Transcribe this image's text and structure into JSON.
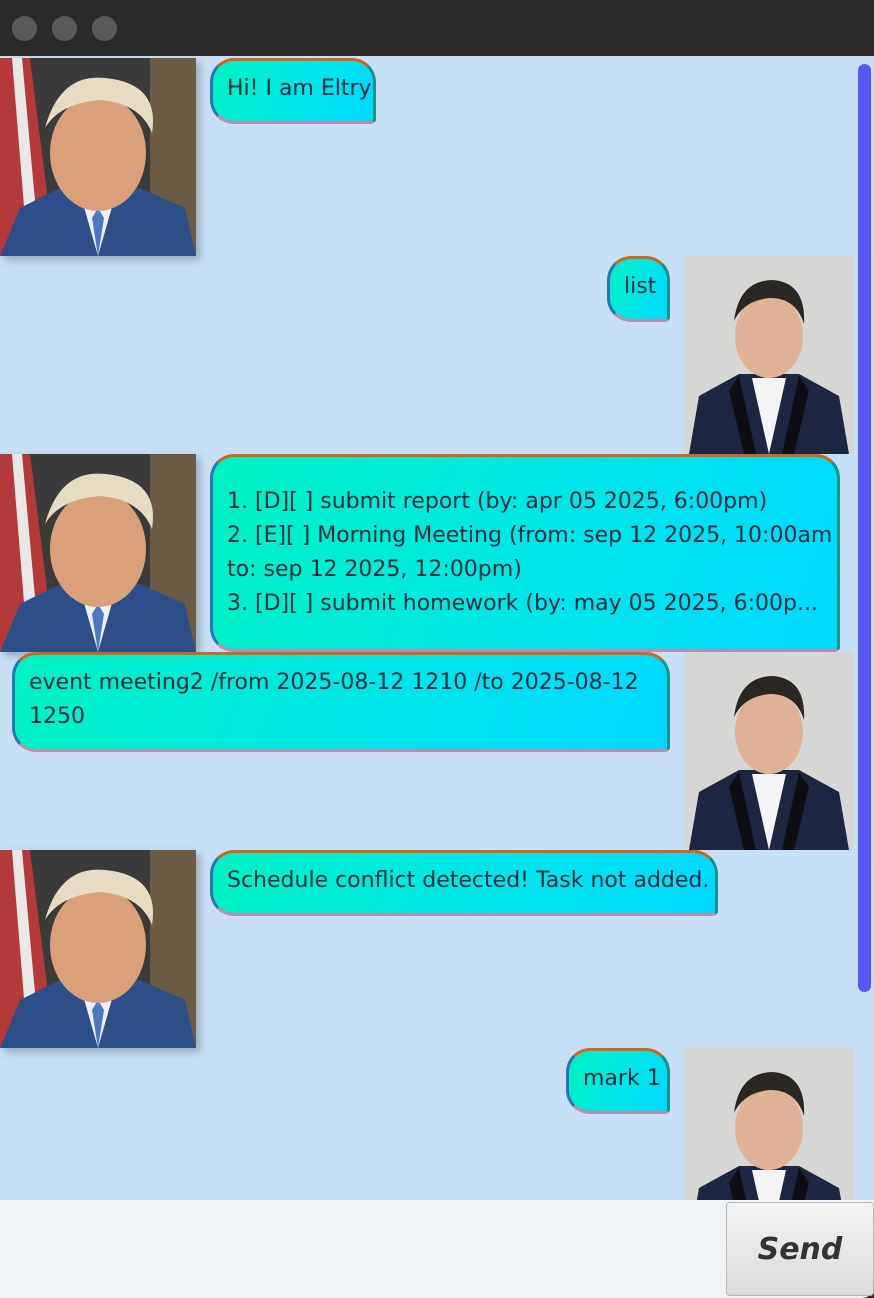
{
  "window": {
    "controls": [
      "close-dot",
      "minimize-dot",
      "zoom-dot"
    ]
  },
  "messages": [
    {
      "sender": "bot",
      "text": "Hi! I am Eltry"
    },
    {
      "sender": "user",
      "text": "list"
    },
    {
      "sender": "bot",
      "text": "1. [D][ ] submit report (by: apr 05 2025, 6:00pm)\n2. [E][ ] Morning Meeting (from: sep 12 2025, 10:00am\nto: sep 12 2025, 12:00pm)\n3. [D][ ] submit homework (by: may 05 2025, 6:00p..."
    },
    {
      "sender": "user",
      "text": "event meeting2 /from 2025-08-12 1210 /to 2025-08-12\n1250"
    },
    {
      "sender": "bot",
      "text": "Schedule conflict detected! Task not added."
    },
    {
      "sender": "user",
      "text": "mark 1"
    }
  ],
  "input": {
    "value": "",
    "placeholder": ""
  },
  "send_label": "Send",
  "colors": {
    "chat_background": "#c8e0f6",
    "bubble_gradient_start": "#00f2c4",
    "bubble_gradient_end": "#00d9ff",
    "scrollbar": "#5a55f5",
    "titlebar": "#2c2b2a"
  },
  "icons": {
    "bot_avatar": "bot-avatar-photo",
    "user_avatar": "user-avatar-photo"
  }
}
